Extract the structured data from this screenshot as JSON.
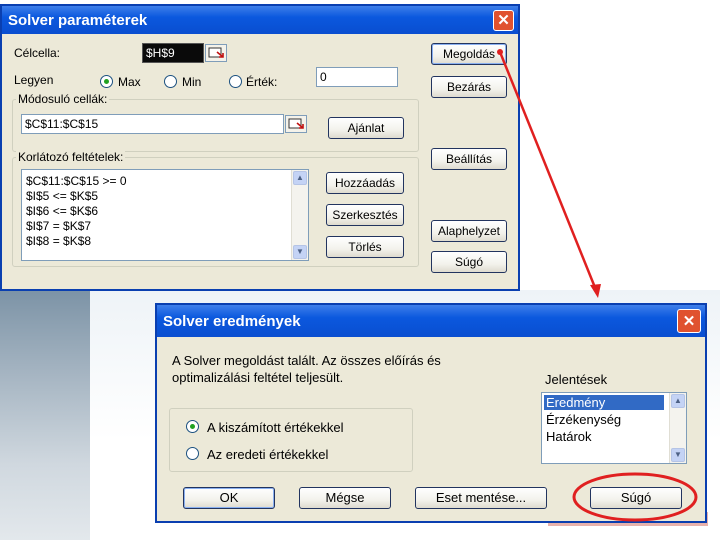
{
  "colors": {
    "title_bar": "#0b58de",
    "dialog_bg": "#ece9d8",
    "arrow": "#e02020",
    "highlight_ring": "#e02020",
    "close_button": "#e0522f",
    "selection": "#316ac5"
  },
  "solver_params": {
    "title": "Solver paraméterek",
    "close_symbol": "✕",
    "target_cell_label": "Célcella:",
    "target_cell_value": "$H$9",
    "equal_to_label": "Legyen",
    "radio_max": "Max",
    "radio_min": "Min",
    "radio_value": "Érték:",
    "value_field": "0",
    "changing_cells_label": "Módosuló cellák:",
    "changing_cells_value": "$C$11:$C$15",
    "guess_button": "Ajánlat",
    "constraints_label": "Korlátozó feltételek:",
    "constraints": [
      "$C$11:$C$15 >= 0",
      "$I$5 <= $K$5",
      "$I$6 <= $K$6",
      "$I$7 = $K$7",
      "$I$8 = $K$8"
    ],
    "add_button": "Hozzáadás",
    "change_button": "Szerkesztés",
    "delete_button": "Törlés",
    "solve_button": "Megoldás",
    "close_button": "Bezárás",
    "options_button": "Beállítás",
    "reset_button": "Alaphelyzet",
    "help_button": "Súgó"
  },
  "solver_results": {
    "title": "Solver eredmények",
    "close_symbol": "✕",
    "message_line1": "A Solver megoldást talált. Az összes előírás és",
    "message_line2": "optimalizálási feltétel teljesült.",
    "reports_label": "Jelentések",
    "reports": [
      "Eredmény",
      "Érzékenység",
      "Határok"
    ],
    "selected_report": "Eredmény",
    "keep_solution": "A kiszámított értékekkel",
    "restore_original": "Az eredeti értékekkel",
    "selected_option": "A kiszámított értékekkel",
    "ok_button": "OK",
    "cancel_button": "Mégse",
    "save_scenario_button": "Eset mentése...",
    "help_button": "Súgó"
  }
}
